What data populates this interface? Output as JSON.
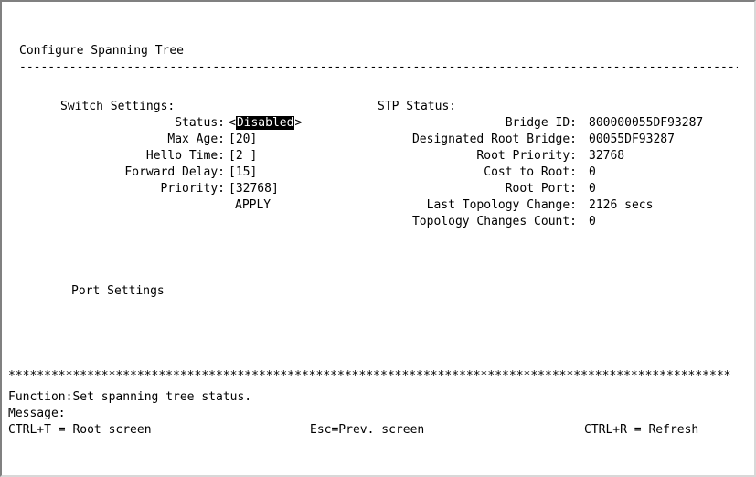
{
  "screen": {
    "title": "Configure Spanning Tree",
    "dash_rule": "-----------------------------------------------------------------------------------------------------",
    "star_rule": "*****************************************************************************************************"
  },
  "switch_settings": {
    "header": "Switch Settings:",
    "status_label": "Status:",
    "status_open": "<",
    "status_value": "Disabled",
    "status_close": ">",
    "max_age_label": "Max Age:",
    "max_age_value": "[20]",
    "hello_time_label": "Hello Time:",
    "hello_time_value": "[2 ]",
    "forward_delay_label": "Forward Delay:",
    "forward_delay_value": "[15]",
    "priority_label": "Priority:",
    "priority_value": "[32768]",
    "apply": "APPLY"
  },
  "stp_status": {
    "header": "STP Status:",
    "bridge_id_label": "Bridge ID:",
    "bridge_id_value": "800000055DF93287",
    "designated_root_label": "Designated Root Bridge:",
    "designated_root_value": "00055DF93287",
    "root_priority_label": "Root Priority:",
    "root_priority_value": "32768",
    "cost_to_root_label": "Cost to Root:",
    "cost_to_root_value": "0",
    "root_port_label": "Root Port:",
    "root_port_value": "0",
    "last_topology_label": "Last Topology Change:",
    "last_topology_value": "2126 secs",
    "topology_count_label": "Topology Changes Count:",
    "topology_count_value": "0"
  },
  "port_settings": "Port Settings",
  "footer": {
    "function_label": "Function:",
    "function_text": "Set spanning tree status.",
    "message_label": "Message:",
    "message_text": "",
    "root_screen": "CTRL+T = Root screen",
    "prev_screen": "Esc=Prev. screen",
    "refresh": "CTRL+R = Refresh"
  }
}
